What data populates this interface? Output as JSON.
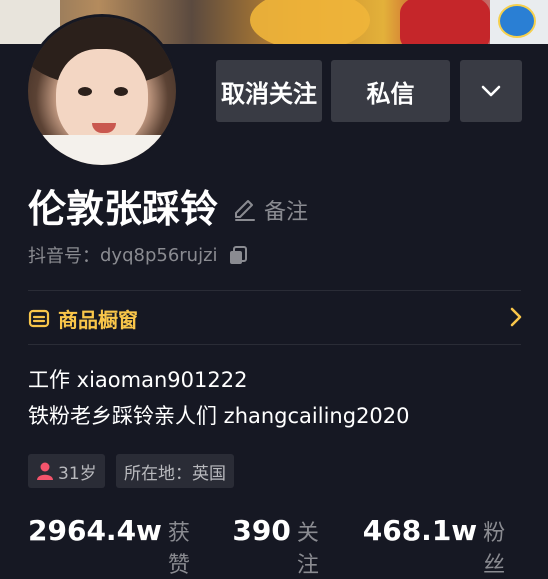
{
  "header": {
    "unfollow_label": "取消关注",
    "message_label": "私信",
    "more_icon": "chevron-down-icon"
  },
  "profile": {
    "name": "伦敦张踩铃",
    "remark_label": "备注",
    "id_prefix": "抖音号：",
    "id_value": "dyq8p56rujzi"
  },
  "shop": {
    "label": "商品橱窗"
  },
  "bio": {
    "line1": "工作 xiaoman901222",
    "line2": "铁粉老乡踩铃亲人们 zhangcailing2020"
  },
  "tags": {
    "age": "31岁",
    "location": "所在地：英国"
  },
  "stats": [
    {
      "num": "2964.4w",
      "label": "获赞"
    },
    {
      "num": "390",
      "label": "关注"
    },
    {
      "num": "468.1w",
      "label": "粉丝"
    }
  ],
  "colors": {
    "background": "#161823",
    "button": "#393b44",
    "accent_gold": "#f9c64a",
    "muted_text": "#8a8b91",
    "gender_pink": "#f3546c"
  }
}
